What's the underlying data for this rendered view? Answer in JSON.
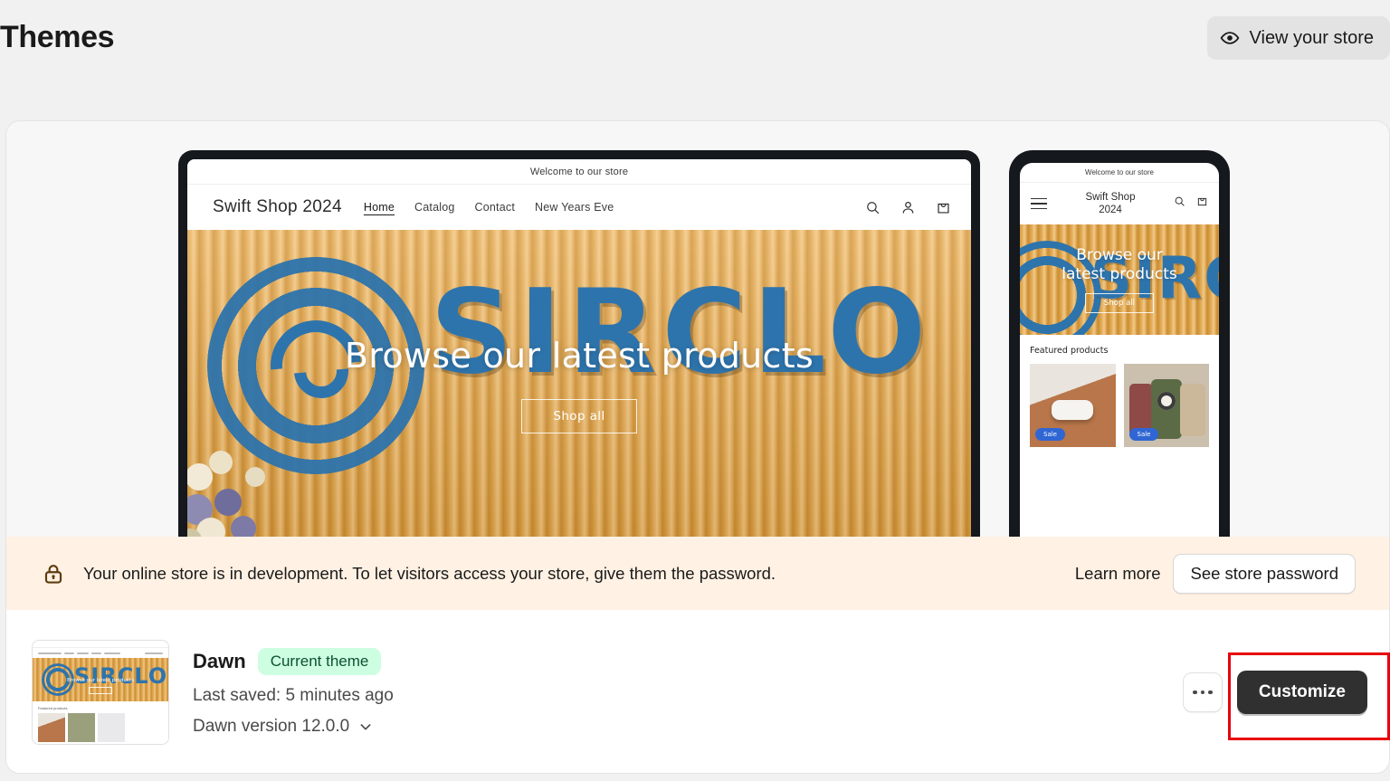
{
  "header": {
    "title": "Themes",
    "view_store_label": "View your store",
    "view_store_icon": "eye-icon"
  },
  "preview": {
    "desktop": {
      "announcement": "Welcome to our store",
      "store_name": "Swift Shop 2024",
      "nav_links": [
        {
          "label": "Home",
          "active": true
        },
        {
          "label": "Catalog",
          "active": false
        },
        {
          "label": "Contact",
          "active": false
        },
        {
          "label": "New Years Eve",
          "active": false
        }
      ],
      "icons": [
        "search-icon",
        "account-icon",
        "cart-icon"
      ],
      "hero_title": "Browse our latest products",
      "hero_button": "Shop all",
      "hero_logo_text": "SIRCLO"
    },
    "mobile": {
      "announcement": "Welcome to our store",
      "store_name_line1": "Swift Shop",
      "store_name_line2": "2024",
      "icons": [
        "hamburger-icon",
        "search-icon",
        "cart-icon"
      ],
      "hero_title_line1": "Browse our",
      "hero_title_line2": "latest products",
      "hero_button": "Shop all",
      "hero_logo_text": "SIRCLO",
      "featured_title": "Featured products",
      "products": [
        {
          "name": "soap-product",
          "badge": "Sale"
        },
        {
          "name": "backpack-product",
          "badge": "Sale"
        }
      ]
    }
  },
  "dev_banner": {
    "icon": "lock-icon",
    "message": "Your online store is in development. To let visitors access your store, give them the password.",
    "learn_more_label": "Learn more",
    "see_password_label": "See store password",
    "background_color": "#FFF1E3"
  },
  "theme": {
    "thumbnail_logo_text": "SIRCLO",
    "thumbnail_hero_title": "Browse our latest products",
    "thumbnail_featured_label": "Featured products",
    "name": "Dawn",
    "badge": "Current theme",
    "badge_color": "#CDFEE1",
    "last_saved": "Last saved: 5 minutes ago",
    "version": "Dawn version 12.0.0",
    "version_chevron": "chevron-down-icon",
    "more_actions_label": "more-actions",
    "customize_label": "Customize",
    "customize_color": "#303030"
  },
  "annotation": {
    "highlight_color": "#E8000D",
    "highlight_target": "customize-button"
  }
}
